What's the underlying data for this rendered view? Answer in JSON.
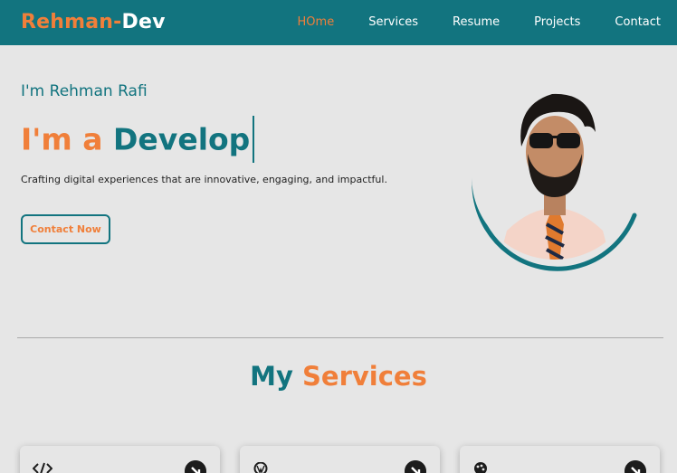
{
  "brand": {
    "part1": "Rehman-",
    "part2": "Dev"
  },
  "nav": {
    "items": [
      "HOme",
      "Services",
      "Resume",
      "Projects",
      "Contact"
    ],
    "active_index": 0
  },
  "hero": {
    "greeting": "I'm Rehman Rafi",
    "headline_prefix": "I'm a",
    "headline_typed": "Develop",
    "tagline": "Crafting digital experiences that are innovative, engaging, and impactful.",
    "cta_label": "Contact Now"
  },
  "services": {
    "title_part1": "My",
    "title_part2": "Services",
    "cards": [
      {
        "icon": "code-icon"
      },
      {
        "icon": "wordpress-icon"
      },
      {
        "icon": "palette-icon"
      }
    ]
  },
  "colors": {
    "teal": "#12747f",
    "orange": "#f07f3a",
    "background": "#e6e6e6"
  }
}
